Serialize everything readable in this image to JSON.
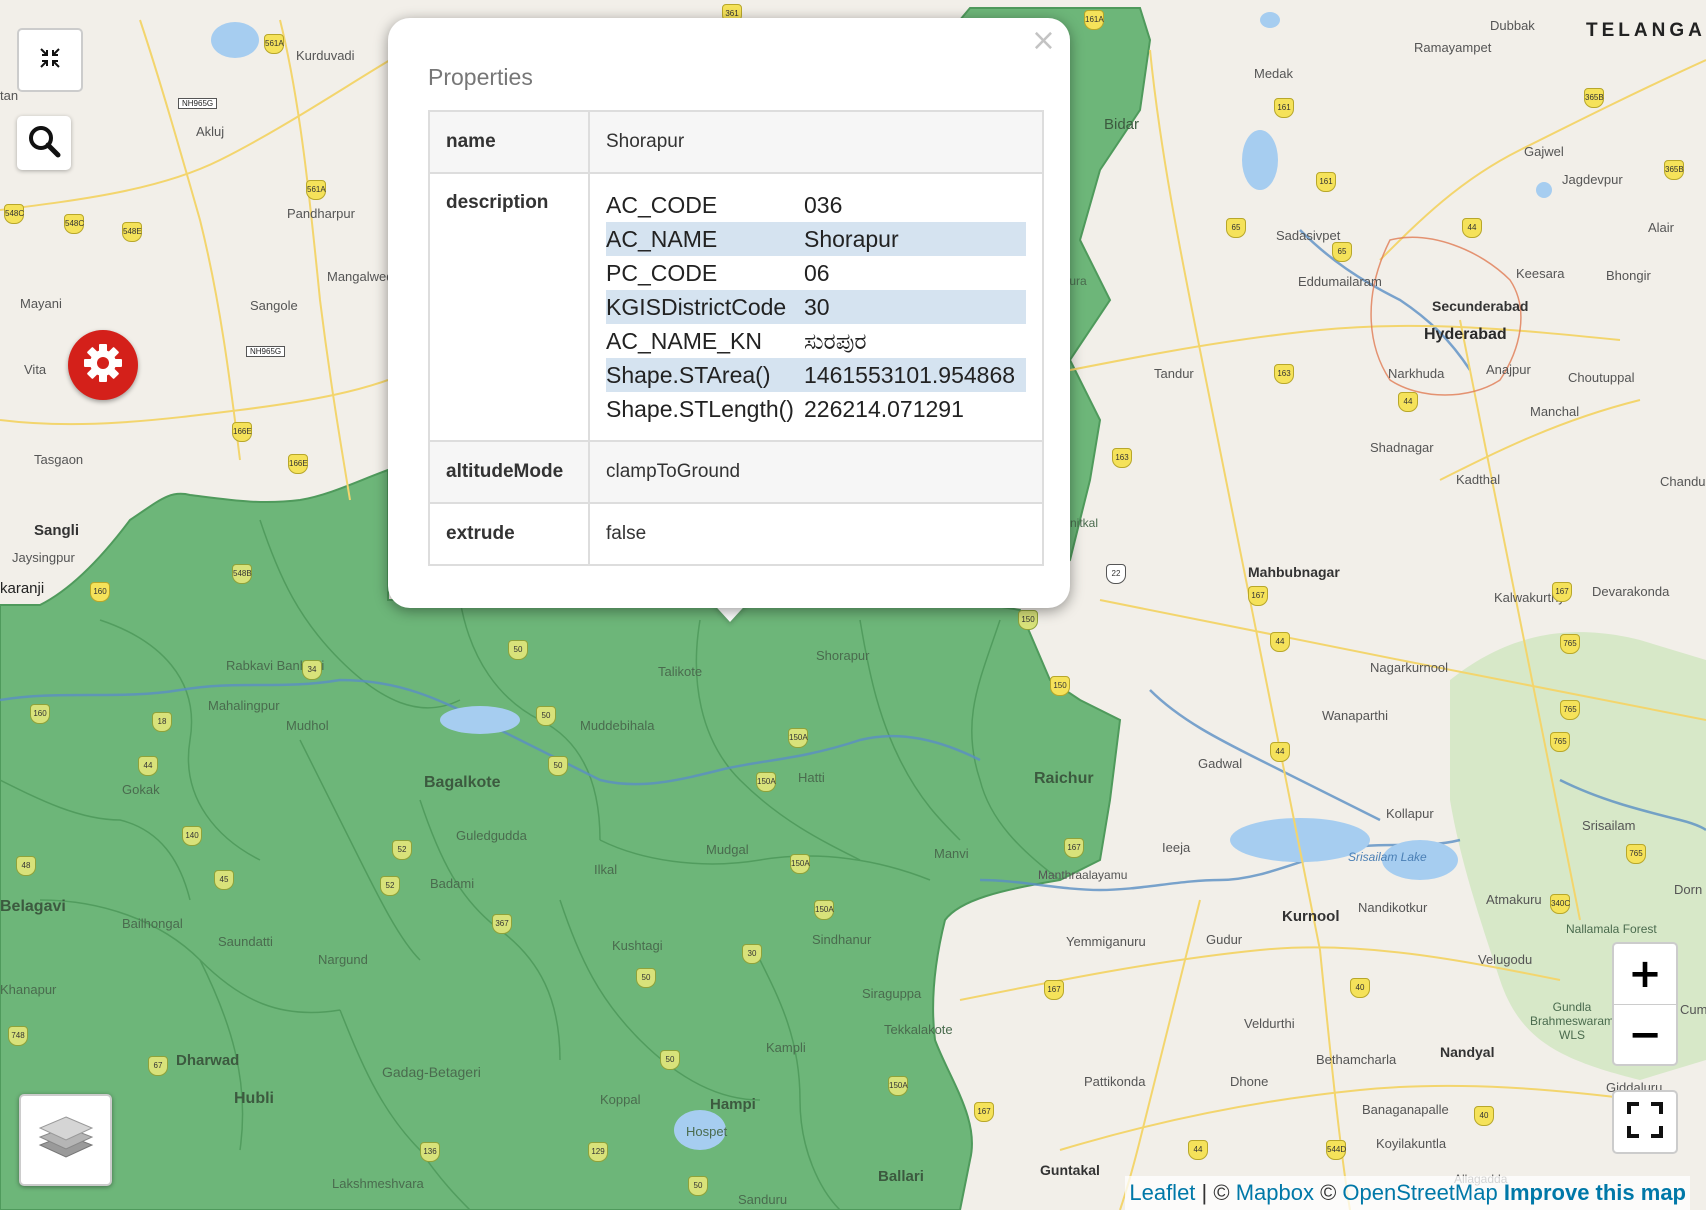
{
  "map": {
    "labels": {
      "kurduvadi": "Kurduvadi",
      "akluj": "Akluj",
      "pandharpur": "Pandharpur",
      "mangalwedha": "Mangalwed",
      "sangole": "Sangole",
      "mayani": "Mayani",
      "vita": "Vita",
      "tasgaon": "Tasgaon",
      "sangli": "Sangli",
      "jaysingpur": "Jaysingpur",
      "karanji": "karanji",
      "rabkavi": "Rabkavi\nBanhatti",
      "mahalingpur": "Mahalingpur",
      "mudhol": "Mudhol",
      "gokak": "Gokak",
      "bagalkote": "Bagalkote",
      "guledgudda": "Guledgudda",
      "badami": "Badami",
      "belagavi": "Belagavi",
      "bailhongal": "Bailhongal",
      "saundatti": "Saundatti",
      "nargund": "Nargund",
      "khanapur": "Khanapur",
      "dharwad": "Dharwad",
      "hubli": "Hubli",
      "gadag": "Gadag-Betageri",
      "lakshmeshvara": "Lakshmeshvara",
      "koppal": "Koppal",
      "hampi": "Hampi",
      "hospet": "Hospet",
      "sandur": "Sanduru",
      "ballari": "Ballari",
      "kampli": "Kampli",
      "kushtagi": "Kushtagi",
      "ilkal": "Ilkal",
      "mudgal": "Mudgal",
      "hatti": "Hatti",
      "sindhanur": "Sindhanur",
      "siraguppa": "Siraguppa",
      "tekkalakote": "Tekkalakote",
      "manvi": "Manvi",
      "raichur": "Raichur",
      "muddebihala": "Muddebihala",
      "talikote": "Talikote",
      "shorapur": "Shorapur",
      "bidar": "Bidar",
      "medak": "Medak",
      "ramayampet": "Ramayampet",
      "dubbak": "Dubbak",
      "telangana": "TELANGA",
      "gajwel": "Gajwel",
      "jagdevpur": "Jagdevpur",
      "alair": "Alair",
      "sadasivpet": "Sadasivpet",
      "eddumailaram": "Eddumailaram",
      "keesara": "Keesara",
      "bhongir": "Bhongir",
      "secunderabad": "Secunderabad",
      "hyderabad": "Hyderabad",
      "narkhuda": "Narkhuda",
      "anajpur": "Anajpur",
      "choutuppal": "Choutuppal",
      "manchal": "Manchal",
      "tandur": "Tandur",
      "shadnagar": "Shadnagar",
      "kadthal": "Kadthal",
      "chandur": "Chandu",
      "mahbubnagar": "Mahbubnagar",
      "kalwakurthy": "Kalwakurthy",
      "devarakonda": "Devarakonda",
      "nagarkurnool": "Nagarkurnool",
      "wanaparthi": "Wanaparthi",
      "gadwal": "Gadwal",
      "kollapur": "Kollapur",
      "srisailam": "Srisailam",
      "srisailam_lake": "Srisailam Lake",
      "ieeja": "Ieeja",
      "manthralayam": "Manthraalayamu",
      "kurnool": "Kurnool",
      "nandikotkur": "Nandikotkur",
      "atmakuru": "Atmakuru",
      "dorn": "Dorn",
      "nallamala": "Nallamala Forest",
      "yemmiganuru": "Yemmiganuru",
      "gudur": "Gudur",
      "velugodu": "Velugodu",
      "gundla": "Gundla\nBrahmeswaram\nWLS",
      "veldurthi": "Veldurthi",
      "bethamcharla": "Bethamcharla",
      "nandyal": "Nandyal",
      "pattikonda": "Pattikonda",
      "dhone": "Dhone",
      "banaganapalle": "Banaganapalle",
      "koyilakuntla": "Koyilakuntla",
      "giddaluru": "Giddaluru",
      "guntakal": "Guntakal",
      "allagadda": "Allagadda",
      "tan": "tan",
      "nithal": "nitkal",
      "andapura": "andapura",
      "cum": "Cum"
    },
    "attribution": {
      "leaflet": "Leaflet",
      "sep": " | © ",
      "mapbox": "Mapbox",
      "sep2": " © ",
      "osm": "OpenStreetMap",
      "improve": "Improve this map"
    },
    "zoom": {
      "in": "+",
      "out": "−"
    }
  },
  "popup": {
    "title": "Properties",
    "close": "×",
    "rows": [
      {
        "key": "name",
        "value": "Shorapur"
      },
      {
        "key": "description"
      },
      {
        "key": "altitudeMode",
        "value": "clampToGround"
      },
      {
        "key": "extrude",
        "value": "false"
      }
    ],
    "description": [
      {
        "k": "AC_CODE",
        "v": "036"
      },
      {
        "k": "AC_NAME",
        "v": "Shorapur"
      },
      {
        "k": "PC_CODE",
        "v": "06"
      },
      {
        "k": "KGISDistrictCode",
        "v": "30"
      },
      {
        "k": "AC_NAME_KN",
        "v": "ಸುರಪುರ"
      },
      {
        "k": "Shape.STArea()",
        "v": "1461553101.954868"
      },
      {
        "k": "Shape.STLength()",
        "v": "226214.071291"
      }
    ]
  },
  "colors": {
    "region_fill": "#6db679",
    "region_border": "#4f9a5c",
    "land": "#f2efe9",
    "water": "#a6cdf0",
    "settings_button": "#d4201a",
    "highlight_row": "#d5e3f0"
  },
  "icons": {
    "collapse": "collapse-arrows-icon",
    "search": "search-icon",
    "settings": "gear-icon",
    "layers": "layers-icon",
    "fullscreen": "fullscreen-icon",
    "close": "close-icon"
  }
}
